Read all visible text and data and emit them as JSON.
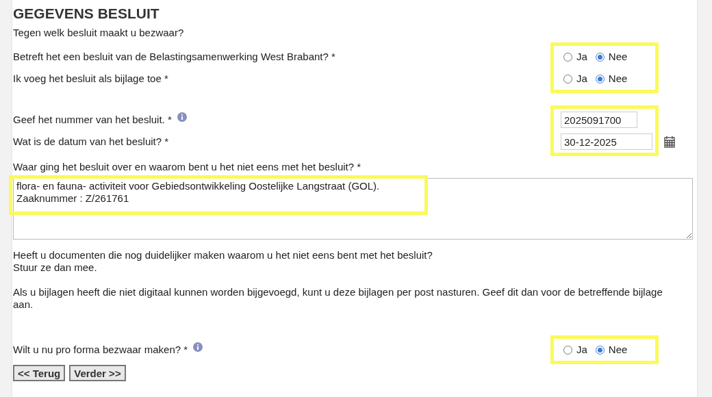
{
  "heading": "GEGEVENS BESLUIT",
  "intro": "Tegen welk besluit maakt u bezwaar?",
  "radio_group_1": {
    "highlighted": true,
    "questions": [
      {
        "label": "Betreft het een besluit van de Belastingsamenwerking West Brabant? *",
        "info": false,
        "options": [
          {
            "label": "Ja",
            "selected": false
          },
          {
            "label": "Nee",
            "selected": true
          }
        ]
      },
      {
        "label": "Ik voeg het besluit als bijlage toe *",
        "info": false,
        "options": [
          {
            "label": "Ja",
            "selected": false
          },
          {
            "label": "Nee",
            "selected": true
          }
        ]
      }
    ]
  },
  "field_group": {
    "highlighted": true,
    "fields": [
      {
        "label": "Geef het nummer van het besluit. *",
        "info": true,
        "value": "2025091700",
        "kind": "text"
      },
      {
        "label": "Wat is de datum van het besluit? *",
        "info": false,
        "value": "30-12-2025",
        "kind": "date"
      }
    ]
  },
  "description": {
    "label": "Waar ging het besluit over en waarom bent u het niet eens met het besluit? *",
    "value": "flora- en fauna- activiteit voor Gebiedsontwikkeling Oostelijke Langstraat (GOL).\nZaaknummer : Z/261761",
    "highlighted": true
  },
  "documents_text": "Heeft u documenten die nog duidelijker maken waarom u het niet eens bent met het besluit?\nStuur ze dan mee.",
  "post_text": "Als u bijlagen heeft die niet digitaal kunnen worden bijgevoegd, kunt u deze bijlagen per post nasturen. Geef dit dan voor de betreffende bijlage aan.",
  "radio_group_2": {
    "highlighted": true,
    "questions": [
      {
        "label": "Wilt u nu pro forma bezwaar maken? *",
        "info": true,
        "options": [
          {
            "label": "Ja",
            "selected": false
          },
          {
            "label": "Nee",
            "selected": true
          }
        ]
      }
    ]
  },
  "buttons": [
    "<< Terug",
    "Verder >>"
  ]
}
